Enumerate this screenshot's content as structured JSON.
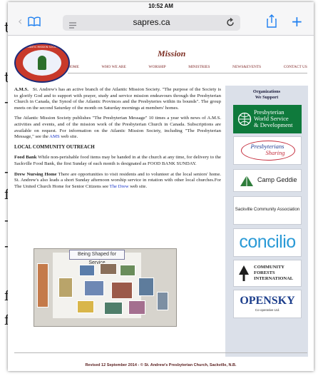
{
  "background_text": [
    "t",
    "t",
    "-",
    "-",
    "f",
    "-",
    "-",
    "f",
    "f"
  ],
  "status_bar": {
    "time": "10:52 AM"
  },
  "browser": {
    "url": "sapres.ca",
    "icons": {
      "back": "back-chevron-icon",
      "forward": "forward-chevron-icon",
      "bookmarks": "book-icon",
      "reader": "reader-lines-icon",
      "reload": "reload-icon",
      "share": "share-icon",
      "new_tab": "plus-icon"
    }
  },
  "site": {
    "logo_text": "ATLANTIC MISSION SOCIETY",
    "title": "Mission",
    "nav": [
      "HOME",
      "WHO WE ARE",
      "WORSHIP",
      "MINISTRIES",
      "NEWS&EVENTS",
      "CONTACT US"
    ]
  },
  "content": {
    "p1_label": "A.M.S.",
    "p1_text": "St. Andrew's has an active branch of the Atlantic Mission Society. \"The purpose of the Society is to glorify God and to support with prayer, study and service mission endeavours through the Presbyterian Church in Canada, the Synod of the Atlantic Provinces and the Presbyteries within its bounds\". The group meets on the second Saturday of the month on Saturday mornings at members' homes.",
    "p2_text": "The Atlantic Mission Society publishes \"The Presbyterian Message\" 10 times a year with news of A.M.S. activities and events, and of the mission work of the Presbyterian Church in Canada. Subscriptions are available on request. For information on the Atlantic Mission Society, including \"The Presbyterian Message,\" see the",
    "p2_link": "AMS",
    "p2_end": "web site.",
    "heading": "LOCAL COMMUNITY OUTREACH",
    "food_label": "Food Bank",
    "food_text": "While non-perishable food items may be handed in at the church at any time, for delivery to the Sackville Food Bank, the first Sunday of each month is designated as FOOD BANK SUNDAY.",
    "drew_label": "Drew Nursing Home",
    "drew_text": "There are opportunities to visit residents and to volunteer at the local seniors' home. St. Andrew's also leads a short Sunday afternoon worship service in rotation with other local churches.For The United Church Home for Senior Citizens see",
    "drew_link": "The Drew",
    "drew_end": "web site.",
    "photo_banner": "Being Shaped for Service"
  },
  "sidebar": {
    "title_line1": "Organizations",
    "title_line2": "We Support",
    "orgs": [
      {
        "name": "Presbyterian",
        "sub": "World Service",
        "sub2": "& Development"
      },
      {
        "name": "Presbyterians",
        "sub": "Sharing"
      },
      {
        "name": "Camp Geddie"
      },
      {
        "name": "Sackville Community Association"
      },
      {
        "name": "concilio"
      },
      {
        "name": "COMMUNITY",
        "sub": "FORESTS",
        "sub2": "INTERNATIONAL"
      },
      {
        "name": "OPENSKY",
        "sub": "Co-operative Ltd."
      }
    ]
  },
  "footer": "Revised 12 September 2014  -  © St. Andrew's Presbyterian Church, Sackville, N.B.",
  "colors": {
    "link": "#1a35c8",
    "ios_blue": "#1d7ff0",
    "pwsd_green": "#0f7a3c",
    "sidebar_bg": "#dbe0e9"
  }
}
